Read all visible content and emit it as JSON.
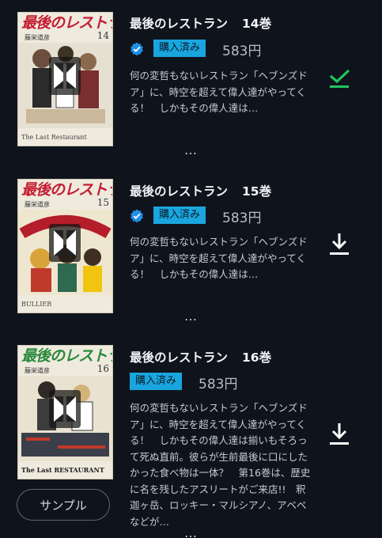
{
  "items": [
    {
      "title": "最後のレストラン",
      "volume": "14巻",
      "purchased_label": "購入済み",
      "price": "583円",
      "verified": true,
      "description": "何の変哲もないレストラン「ヘブンズドア」に、時空を超えて偉人達がやってくる！　しかもその偉人達は…",
      "action_icon": "check-icon",
      "cover": {
        "title": "最後のレストラン",
        "volume": "14",
        "author": "藤栄道彦",
        "subtitle": "The Last Restaurant"
      }
    },
    {
      "title": "最後のレストラン",
      "volume": "15巻",
      "purchased_label": "購入済み",
      "price": "583円",
      "verified": true,
      "description": "何の変哲もないレストラン「ヘブンズドア」に、時空を超えて偉人達がやってくる！　しかもその偉人達は…",
      "action_icon": "download-icon",
      "cover": {
        "title": "最後のレストラン",
        "volume": "15",
        "author": "藤栄道彦",
        "subtitle": "BULLIER"
      }
    },
    {
      "title": "最後のレストラン",
      "volume": "16巻",
      "purchased_label": "購入済み",
      "price": "583円",
      "verified": false,
      "description": "何の変哲もないレストラン「ヘブンズドア」に、時空を超えて偉人達がやってくる！　しかもその偉人達は揃いもそろって死ぬ直前。彼らが生前最後に口にしたかった食べ物は一体？　第16巻は、歴史に名を残したアスリートがご来店!!　釈迦ヶ岳、ロッキー・マルシアノ、アベベなどが…",
      "action_icon": "download-icon",
      "cover": {
        "title": "最後のレストラン",
        "volume": "16",
        "author": "藤栄道彦",
        "subtitle": "The Last RESTAURANT"
      }
    }
  ],
  "more_glyph": "…",
  "sample_button": "サンプル",
  "colors": {
    "background": "#0f141c",
    "purchased_badge": "#19a6df",
    "check": "#22c55e",
    "verified": "#1e90e6"
  }
}
